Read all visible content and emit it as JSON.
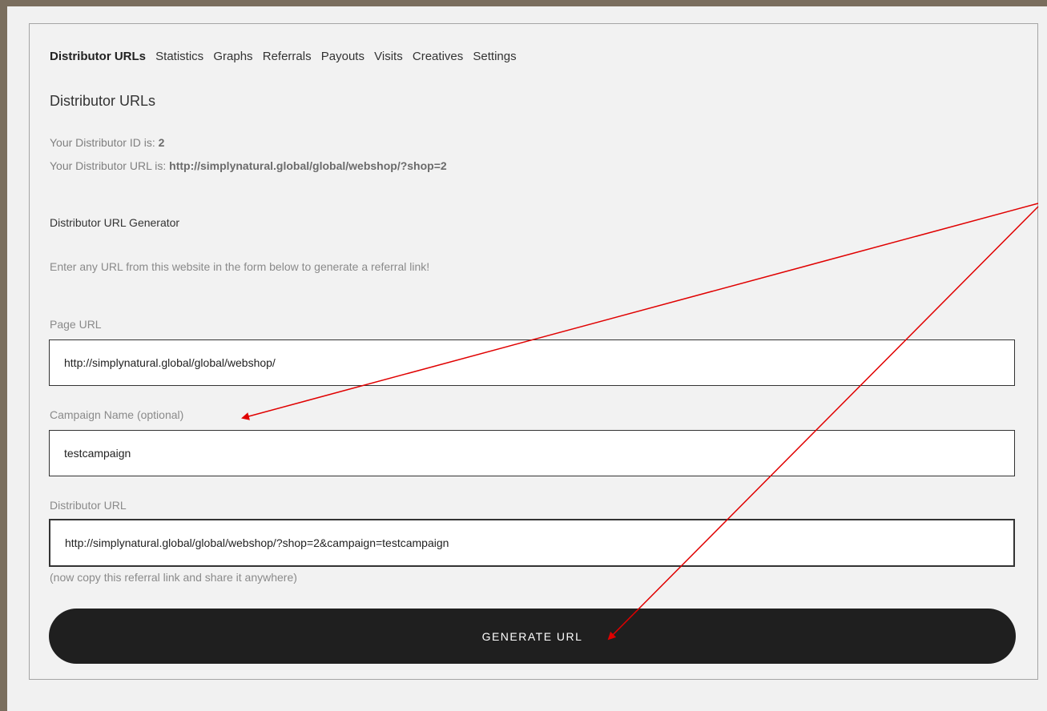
{
  "tabs": [
    {
      "label": "Distributor URLs",
      "active": true
    },
    {
      "label": "Statistics"
    },
    {
      "label": "Graphs"
    },
    {
      "label": "Referrals"
    },
    {
      "label": "Payouts"
    },
    {
      "label": "Visits"
    },
    {
      "label": "Creatives"
    },
    {
      "label": "Settings"
    }
  ],
  "section_title": "Distributor URLs",
  "distributor": {
    "id_label": "Your Distributor ID is: ",
    "id_value": "2",
    "url_label": "Your Distributor URL is: ",
    "url_value": "http://simplynatural.global/global/webshop/?shop=2"
  },
  "generator": {
    "title": "Distributor URL Generator",
    "description": "Enter any URL from this website in the form below to generate a referral link!"
  },
  "form": {
    "page_url_label": "Page URL",
    "page_url_value": "http://simplynatural.global/global/webshop/",
    "campaign_label": "Campaign Name (optional)",
    "campaign_value": "testcampaign",
    "distributor_url_label": "Distributor URL",
    "distributor_url_value": "http://simplynatural.global/global/webshop/?shop=2&campaign=testcampaign",
    "hint": "(now copy this referral link and share it anywhere)",
    "button_label": "GENERATE URL"
  },
  "annotation_color": "#e00000"
}
